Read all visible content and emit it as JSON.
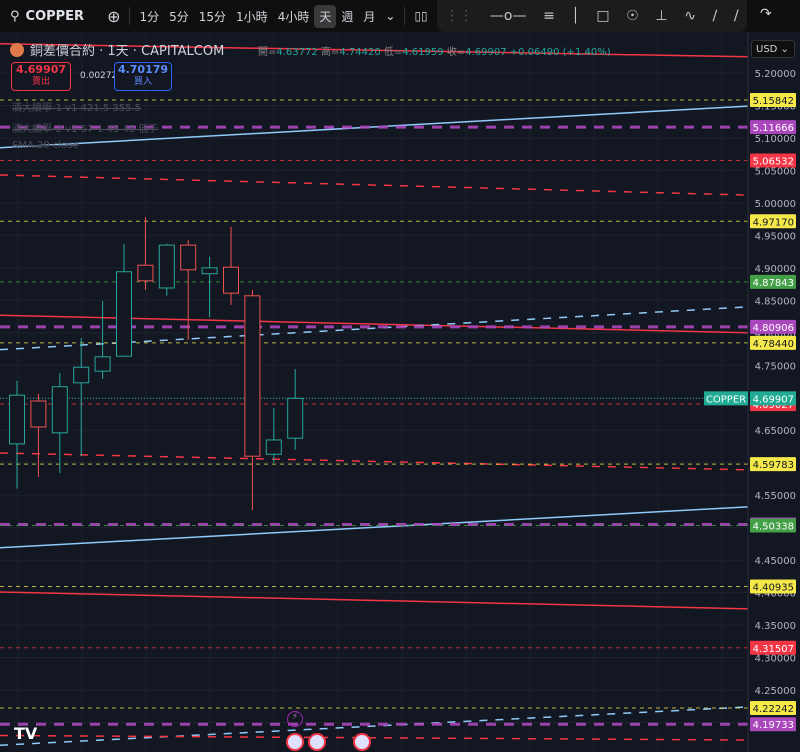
{
  "toolbar": {
    "symbol": "COPPER",
    "intervals": [
      "1分",
      "5分",
      "15分",
      "1小時",
      "4小時",
      "天",
      "週",
      "月"
    ],
    "active_interval": "天",
    "tools": [
      "horizontal-ray",
      "parallel-lines",
      "vertical-line",
      "rectangle",
      "circle",
      "price-range",
      "path",
      "trend-line",
      "ray",
      "redo"
    ]
  },
  "legend": {
    "title": "銅差價合約 · 1天 · CAPITALCOM",
    "open_label": "開=",
    "open": "4.63772",
    "high_label": "高=",
    "high": "4.74420",
    "low_label": "低=",
    "low": "4.61959",
    "close_label": "收=",
    "close": "4.69907",
    "change": "+0.06490 (+1.40%)",
    "sell_price": "4.69907",
    "sell_label": "賣出",
    "spread": "0.00272",
    "buy_price": "4.70179",
    "buy_label": "買入",
    "indicators": [
      "酒大續學-1 v1 421.5 355.5",
      "酒大續學-2 v1 57-1 45 45 低于",
      "SMA 20 close"
    ]
  },
  "currency": "USD",
  "colors": {
    "up": "#26a69a",
    "down": "#ef5350",
    "yellow": "#f5e94a",
    "purple": "#ab47bc",
    "green": "#43a047",
    "red": "#f23645",
    "blue": "#90caf9",
    "teal": "#22ab94"
  },
  "chart_data": {
    "type": "candlestick",
    "title": "銅差價合約 · 1天 · CAPITALCOM",
    "ylim": [
      4.175,
      5.2388
    ],
    "grid": true,
    "y_ticks": [
      "5.20000",
      "5.15000",
      "5.10000",
      "5.05000",
      "5.00000",
      "4.95000",
      "4.90000",
      "4.85000",
      "4.80000",
      "4.75000",
      "4.70000",
      "4.65000",
      "4.60000",
      "4.55000",
      "4.50000",
      "4.45000",
      "4.40000",
      "4.35000",
      "4.30000",
      "4.25000",
      "4.20000"
    ],
    "candles": [
      {
        "o": 4.629,
        "h": 4.726,
        "l": 4.56,
        "c": 4.704
      },
      {
        "o": 4.695,
        "h": 4.706,
        "l": 4.578,
        "c": 4.655
      },
      {
        "o": 4.646,
        "h": 4.738,
        "l": 4.584,
        "c": 4.717
      },
      {
        "o": 4.723,
        "h": 4.792,
        "l": 4.61,
        "c": 4.747
      },
      {
        "o": 4.741,
        "h": 4.849,
        "l": 4.729,
        "c": 4.763
      },
      {
        "o": 4.764,
        "h": 4.937,
        "l": 4.764,
        "c": 4.894
      },
      {
        "o": 4.904,
        "h": 4.978,
        "l": 4.866,
        "c": 4.88
      },
      {
        "o": 4.869,
        "h": 4.937,
        "l": 4.857,
        "c": 4.935
      },
      {
        "o": 4.935,
        "h": 4.943,
        "l": 4.789,
        "c": 4.897
      },
      {
        "o": 4.891,
        "h": 4.917,
        "l": 4.824,
        "c": 4.9
      },
      {
        "o": 4.901,
        "h": 4.963,
        "l": 4.843,
        "c": 4.861
      },
      {
        "o": 4.857,
        "h": 4.866,
        "l": 4.527,
        "c": 4.61
      },
      {
        "o": 4.613,
        "h": 4.684,
        "l": 4.6,
        "c": 4.635
      },
      {
        "o": 4.63772,
        "h": 4.7442,
        "l": 4.61959,
        "c": 4.69907
      }
    ],
    "levels": [
      {
        "price": "5.15842",
        "color": "yellow",
        "style": "dash-fine"
      },
      {
        "price": "5.11666",
        "color": "purple",
        "style": "dash-thick"
      },
      {
        "price": "5.06532",
        "color": "red",
        "style": "dash-fine"
      },
      {
        "price": "4.97170",
        "color": "yellow",
        "style": "dash-fine"
      },
      {
        "price": "4.87843",
        "color": "green",
        "style": "dash-fine"
      },
      {
        "price": "4.80906",
        "color": "purple",
        "style": "dash-thick"
      },
      {
        "price": "4.78440",
        "color": "yellow",
        "style": "dash-fine"
      },
      {
        "price": "4.69027",
        "color": "red",
        "style": "dash-fine"
      },
      {
        "price": "4.59783",
        "color": "yellow",
        "style": "dash-fine"
      },
      {
        "price": "4.50493",
        "color": "purple",
        "style": "dash-thick"
      },
      {
        "price": "4.50338",
        "color": "green",
        "style": "dash-fine"
      },
      {
        "price": "4.40935",
        "color": "yellow",
        "style": "dash-fine"
      },
      {
        "price": "4.31507",
        "color": "red",
        "style": "dash-fine"
      },
      {
        "price": "4.22242",
        "color": "yellow",
        "style": "dash-fine"
      },
      {
        "price": "4.19733",
        "color": "purple",
        "style": "dash-thick"
      }
    ],
    "last_price": {
      "label": "COPPER",
      "price": "4.69907"
    },
    "trend_lines": [
      {
        "from": 5.245,
        "to": 5.225,
        "color": "red",
        "style": "solid"
      },
      {
        "from": 5.085,
        "to": 5.149,
        "color": "blue",
        "style": "solid"
      },
      {
        "from": 5.043,
        "to": 5.012,
        "color": "red",
        "style": "dash-long"
      },
      {
        "from": 4.827,
        "to": 4.8,
        "color": "red",
        "style": "solid"
      },
      {
        "from": 4.774,
        "to": 4.84,
        "color": "blue",
        "style": "dash-long"
      },
      {
        "from": 4.615,
        "to": 4.589,
        "color": "red",
        "style": "dash-long"
      },
      {
        "from": 4.469,
        "to": 4.532,
        "color": "blue",
        "style": "solid"
      },
      {
        "from": 4.401,
        "to": 4.375,
        "color": "red",
        "style": "solid"
      },
      {
        "from": 4.165,
        "to": 4.224,
        "color": "blue",
        "style": "dash-long"
      },
      {
        "from": 4.18,
        "to": 4.173,
        "color": "red",
        "style": "dash-long"
      }
    ]
  }
}
